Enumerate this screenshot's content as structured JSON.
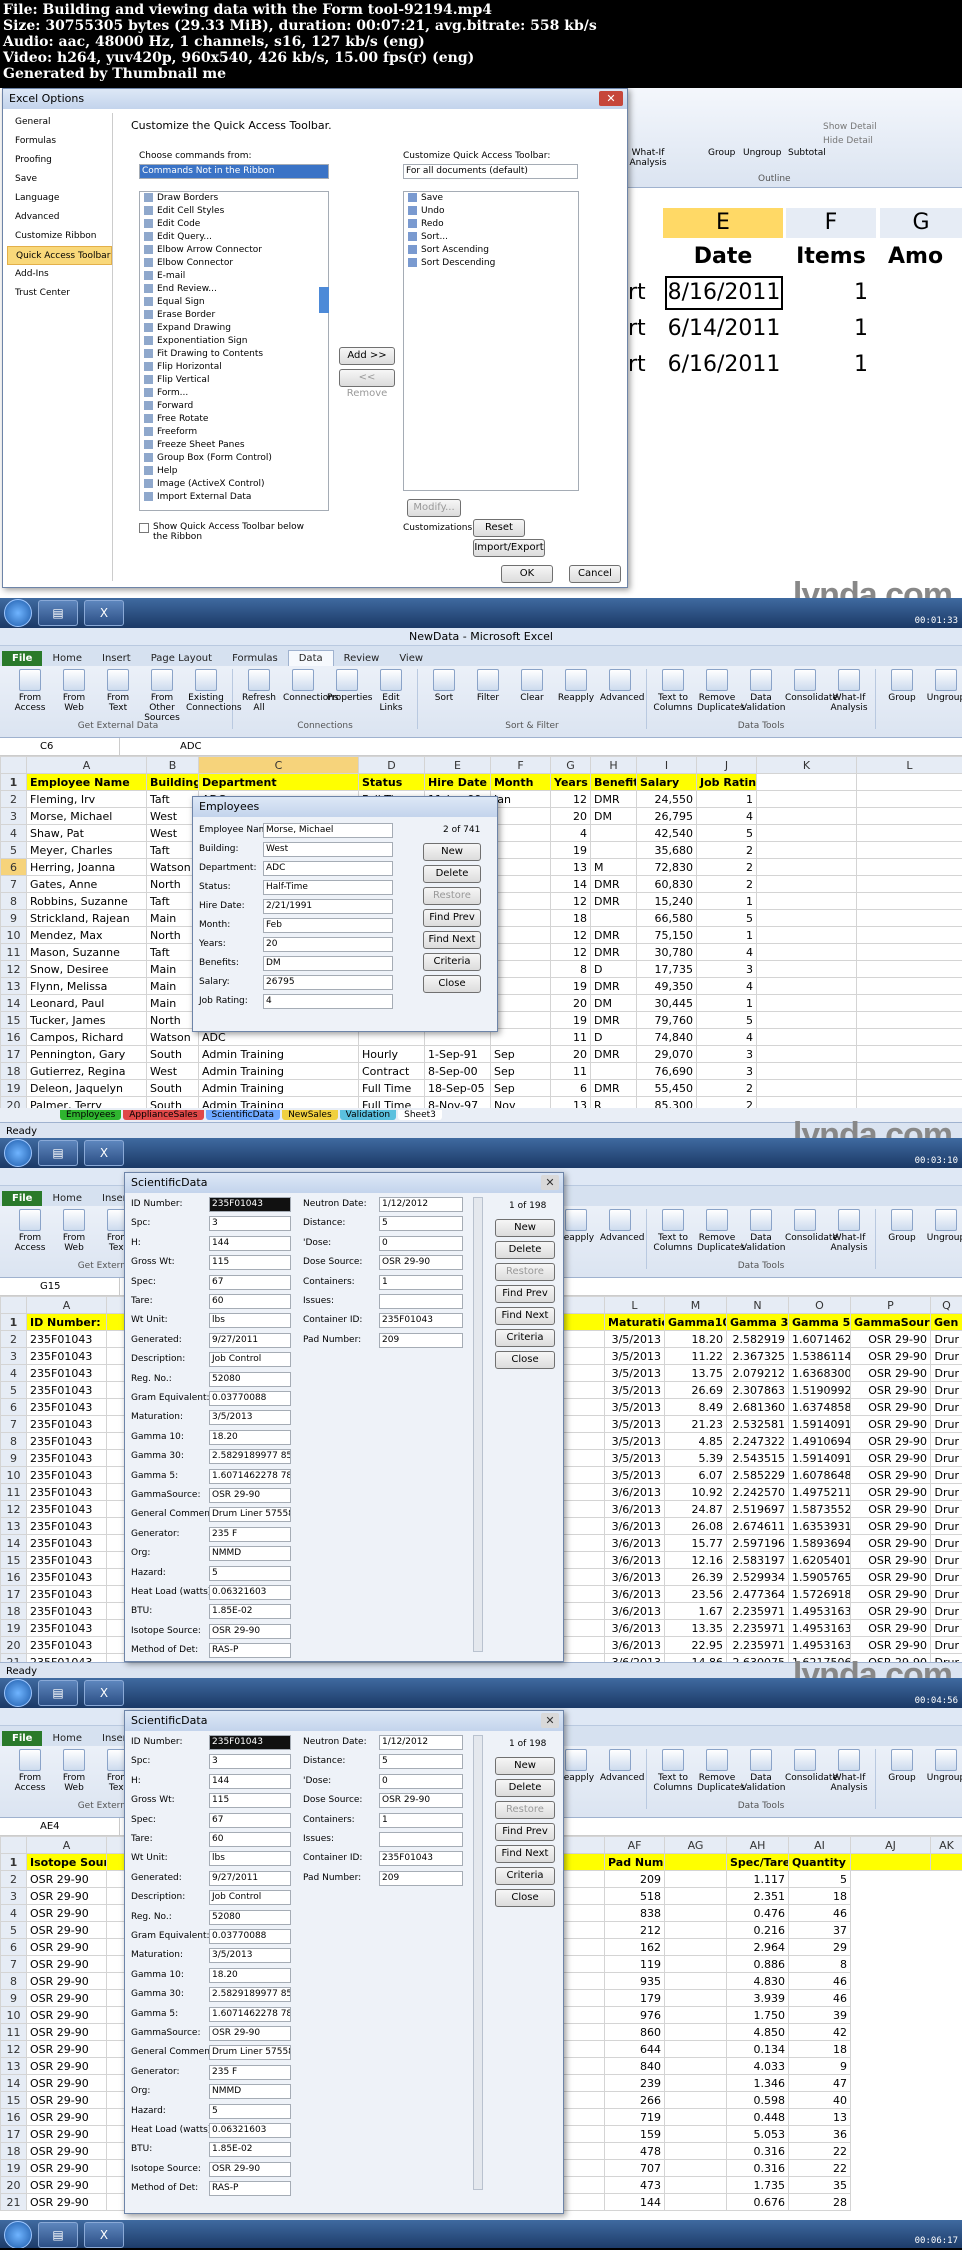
{
  "header": {
    "lines": [
      "File: Building and viewing data with the Form tool-92194.mp4",
      "Size: 30755305 bytes (29.33 MiB), duration: 00:07:21, avg.bitrate: 558 kb/s",
      "Audio: aac, 48000 Hz, 1 channels, s16, 127 kb/s (eng)",
      "Video: h264, yuv420p, 960x540, 426 kb/s, 15.00 fps(r) (eng)",
      "Generated by Thumbnail me"
    ]
  },
  "brand": "lynda.com",
  "timestamps": [
    "00:01:33",
    "00:03:10",
    "00:04:56",
    "00:06:17"
  ],
  "frame1": {
    "dialog_title": "Excel Options",
    "categories": [
      "General",
      "Formulas",
      "Proofing",
      "Save",
      "Language",
      "Advanced",
      "Customize Ribbon",
      "Quick Access Toolbar",
      "Add-Ins",
      "Trust Center"
    ],
    "selected_category": "Quick Access Toolbar",
    "heading": "Customize the Quick Access Toolbar.",
    "choose_label": "Choose commands from:",
    "choose_value": "Commands Not in the Ribbon",
    "customize_label": "Customize Quick Access Toolbar:",
    "customize_value": "For all documents (default)",
    "commands": [
      "Draw Borders",
      "Edit Cell Styles",
      "Edit Code",
      "Edit Query...",
      "Elbow Arrow Connector",
      "Elbow Connector",
      "E-mail",
      "End Review...",
      "Equal Sign",
      "Erase Border",
      "Expand Drawing",
      "Exponentiation Sign",
      "Fit Drawing to Contents",
      "Flip Horizontal",
      "Flip Vertical",
      "Form...",
      "Forward",
      "Free Rotate",
      "Freeform",
      "Freeze Sheet Panes",
      "Group Box (Form Control)",
      "Help",
      "Image (ActiveX Control)",
      "Import External Data"
    ],
    "qat_items": [
      "Save",
      "Undo",
      "Redo",
      "Sort...",
      "Sort Ascending",
      "Sort Descending"
    ],
    "add_btn": "Add >>",
    "remove_btn": "<< Remove",
    "modify_btn": "Modify...",
    "customizations": "Customizations:",
    "reset_btn": "Reset",
    "import_btn": "Import/Export",
    "show_below": "Show Quick Access Toolbar below the Ribbon",
    "ok": "OK",
    "cancel": "Cancel",
    "bg_headers": [
      "E",
      "F",
      "G"
    ],
    "bg_cols": [
      "Date",
      "Items",
      "Amo"
    ],
    "bg_rows": [
      [
        "rt",
        "8/16/2011",
        "1"
      ],
      [
        "rt",
        "6/14/2011",
        "1"
      ],
      [
        "rt",
        "6/16/2011",
        "1"
      ]
    ],
    "bg_ribbon": [
      "date",
      "What-If Analysis",
      "Group",
      "Ungroup",
      "Subtotal",
      "Show Detail",
      "Hide Detail",
      "Outline"
    ]
  },
  "frame2": {
    "window_title": "NewData - Microsoft Excel",
    "tabs": [
      "File",
      "Home",
      "Insert",
      "Page Layout",
      "Formulas",
      "Data",
      "Review",
      "View"
    ],
    "active_tab": "Data",
    "groups": [
      {
        "label": "Get External Data",
        "buttons": [
          "From Access",
          "From Web",
          "From Text",
          "From Other Sources",
          "Existing Connections"
        ]
      },
      {
        "label": "Connections",
        "buttons": [
          "Refresh All",
          "Connections",
          "Properties",
          "Edit Links"
        ]
      },
      {
        "label": "Sort & Filter",
        "buttons": [
          "Sort",
          "Filter",
          "Clear",
          "Reapply",
          "Advanced"
        ]
      },
      {
        "label": "Data Tools",
        "buttons": [
          "Text to Columns",
          "Remove Duplicates",
          "Data Validation",
          "Consolidate",
          "What-If Analysis"
        ]
      },
      {
        "label": "Outline",
        "buttons": [
          "Group",
          "Ungroup",
          "Subtotal",
          "Show Detail",
          "Hide Detail"
        ]
      }
    ],
    "name_box": "C6",
    "formula": "ADC",
    "col_letters": [
      "A",
      "B",
      "C",
      "D",
      "E",
      "F",
      "G",
      "H",
      "I",
      "J",
      "K",
      "L"
    ],
    "headers": [
      "Employee Name",
      "Building",
      "Department",
      "Status",
      "Hire Date",
      "Month",
      "Years",
      "Benefits",
      "Salary",
      "Job Rating"
    ],
    "rows": [
      [
        "Fleming, Irv",
        "Taft",
        "ADC",
        "Full Time",
        "11-Jan-99",
        "Jan",
        "12",
        "DMR",
        "24,550",
        "1"
      ],
      [
        "Morse, Michael",
        "West",
        "ADC",
        "Half-Time",
        "",
        "",
        "20",
        "DM",
        "26,795",
        "4"
      ],
      [
        "Shaw, Pat",
        "West",
        "ADC",
        "",
        "",
        "",
        "4",
        "",
        "42,540",
        "5"
      ],
      [
        "Meyer, Charles",
        "Taft",
        "ADC",
        "",
        "",
        "",
        "19",
        "",
        "35,680",
        "2"
      ],
      [
        "Herring, Joanna",
        "Watson",
        "ADC",
        "",
        "",
        "",
        "13",
        "M",
        "72,830",
        "2"
      ],
      [
        "Gates, Anne",
        "North",
        "ADC",
        "",
        "",
        "",
        "14",
        "DMR",
        "60,830",
        "2"
      ],
      [
        "Robbins, Suzanne",
        "Taft",
        "ADC",
        "",
        "",
        "",
        "12",
        "DMR",
        "15,240",
        "1"
      ],
      [
        "Strickland, Rajean",
        "Main",
        "ADC",
        "",
        "",
        "",
        "18",
        "",
        "66,580",
        "5"
      ],
      [
        "Mendez, Max",
        "North",
        "ADC",
        "",
        "",
        "",
        "12",
        "DMR",
        "75,150",
        "1"
      ],
      [
        "Mason, Suzanne",
        "Taft",
        "ADC",
        "",
        "",
        "",
        "12",
        "DMR",
        "30,780",
        "4"
      ],
      [
        "Snow, Desiree",
        "Main",
        "ADC",
        "",
        "",
        "",
        "8",
        "D",
        "17,735",
        "3"
      ],
      [
        "Flynn, Melissa",
        "Main",
        "ADC",
        "",
        "",
        "",
        "19",
        "DMR",
        "49,350",
        "4"
      ],
      [
        "Leonard, Paul",
        "Main",
        "ADC",
        "",
        "",
        "",
        "20",
        "DM",
        "30,445",
        "1"
      ],
      [
        "Tucker, James",
        "North",
        "ADC",
        "",
        "",
        "",
        "19",
        "DMR",
        "79,760",
        "5"
      ],
      [
        "Campos, Richard",
        "Watson",
        "ADC",
        "",
        "",
        "",
        "11",
        "D",
        "74,840",
        "4"
      ],
      [
        "Pennington, Gary",
        "South",
        "Admin Training",
        "Hourly",
        "1-Sep-91",
        "Sep",
        "20",
        "DMR",
        "29,070",
        "3"
      ],
      [
        "Gutierrez, Regina",
        "West",
        "Admin Training",
        "Contract",
        "8-Sep-00",
        "Sep",
        "11",
        "",
        "76,690",
        "3"
      ],
      [
        "Deleon, Jaquelyn",
        "South",
        "Admin Training",
        "Full Time",
        "18-Sep-05",
        "Sep",
        "6",
        "DMR",
        "55,450",
        "2"
      ],
      [
        "Palmer, Terry",
        "South",
        "Admin Training",
        "Full Time",
        "8-Nov-97",
        "Nov",
        "13",
        "R",
        "85,300",
        "2"
      ]
    ],
    "sheet_tabs": [
      "Employees",
      "ApplianceSales",
      "ScientificData",
      "NewSales",
      "Validation",
      "Sheet3"
    ],
    "status": "Ready",
    "form_title": "Employees",
    "form_record": "2 of 741",
    "form_fields": [
      [
        "Employee Name:",
        "Morse, Michael"
      ],
      [
        "Building:",
        "West"
      ],
      [
        "Department:",
        "ADC"
      ],
      [
        "Status:",
        "Half-Time"
      ],
      [
        "Hire Date:",
        "2/21/1991"
      ],
      [
        "Month:",
        "Feb"
      ],
      [
        "Years:",
        "20"
      ],
      [
        "Benefits:",
        "DM"
      ],
      [
        "Salary:",
        "26795"
      ],
      [
        "Job Rating:",
        "4"
      ]
    ],
    "form_buttons": [
      "New",
      "Delete",
      "Restore",
      "Find Prev",
      "Find Next",
      "Criteria",
      "Close"
    ]
  },
  "frame3": {
    "name_box": "G15",
    "form_title": "ScientificData",
    "form_record": "1 of 198",
    "left_fields": [
      [
        "ID Number:",
        "235F01043"
      ],
      [
        "Spc:",
        "3"
      ],
      [
        "H:",
        "144"
      ],
      [
        "Gross Wt:",
        "115"
      ],
      [
        "Spec:",
        "67"
      ],
      [
        "Tare:",
        "60"
      ],
      [
        "Wt Unit:",
        "lbs"
      ],
      [
        "Generated:",
        "9/27/2011"
      ],
      [
        "Description:",
        "Job Control"
      ],
      [
        "Reg. No.:",
        "52080"
      ],
      [
        "Gram Equivalent:",
        "0.03770088"
      ],
      [
        "Maturation:",
        "3/5/2013"
      ],
      [
        "Gamma 10:",
        "18.20"
      ],
      [
        "Gamma 30:",
        "2.5829189977 8549"
      ],
      [
        "Gamma 5:",
        "1.6071462278 7894"
      ],
      [
        "GammaSource:",
        "OSR 29-90"
      ],
      [
        "General Comments:",
        "Drum Liner 57558"
      ],
      [
        "Generator:",
        "235 F"
      ],
      [
        "Org:",
        "NMMD"
      ],
      [
        "Hazard:",
        "5"
      ],
      [
        "Heat Load (watts):",
        "0.06321603"
      ],
      [
        "BTU:",
        "1.85E-02"
      ],
      [
        "Isotope Source:",
        "OSR 29-90"
      ],
      [
        "Method of Det:",
        "RAS-P"
      ]
    ],
    "right_fields": [
      [
        "Neutron Date:",
        "1/12/2012"
      ],
      [
        "Distance:",
        "5"
      ],
      [
        "'Dose:",
        "0"
      ],
      [
        "Dose Source:",
        "OSR 29-90"
      ],
      [
        "Containers:",
        "1"
      ],
      [
        "Issues:",
        ""
      ],
      [
        "Container ID:",
        "235F01043"
      ],
      [
        "Pad Number:",
        "209"
      ]
    ],
    "form_buttons": [
      "New",
      "Delete",
      "Restore",
      "Find Prev",
      "Find Next",
      "Criteria",
      "Close"
    ],
    "bg_col_letters": [
      "L",
      "M",
      "N",
      "O",
      "P",
      "Q"
    ],
    "bg_headers": [
      "Maturation",
      "Gamma10",
      "Gamma 30",
      "Gamma 5",
      "GammaSource",
      "Gen"
    ],
    "bg_rows": [
      [
        "3/5/2013",
        "18.20",
        "2.582919",
        "1.607146228",
        "OSR 29-90",
        "Drur"
      ],
      [
        "3/5/2013",
        "11.22",
        "2.367325",
        "1.53861148",
        "OSR 29-90",
        "Drur"
      ],
      [
        "3/5/2013",
        "13.75",
        "2.079212",
        "1.636830008",
        "OSR 29-90",
        "Drur"
      ],
      [
        "3/5/2013",
        "26.69",
        "2.307863",
        "1.519099293",
        "OSR 29-90",
        "Drur"
      ],
      [
        "3/5/2013",
        "8.49",
        "2.681360",
        "1.637485848",
        "OSR 29-90",
        "Drur"
      ],
      [
        "3/5/2013",
        "21.23",
        "2.532581",
        "1.59140914",
        "OSR 29-90",
        "Drur"
      ],
      [
        "3/5/2013",
        "4.85",
        "2.247322",
        "1.49106943",
        "OSR 29-90",
        "Drur"
      ],
      [
        "3/5/2013",
        "5.39",
        "2.543515",
        "1.59140914",
        "OSR 29-90",
        "Drur"
      ],
      [
        "3/5/2013",
        "6.07",
        "2.585229",
        "1.607864825",
        "OSR 29-90",
        "Drur"
      ],
      [
        "3/6/2013",
        "10.92",
        "2.242570",
        "1.497521171",
        "OSR 29-90",
        "Drur"
      ],
      [
        "3/6/2013",
        "24.87",
        "2.519697",
        "1.587355267",
        "OSR 29-90",
        "Drur"
      ],
      [
        "3/6/2013",
        "26.08",
        "2.674611",
        "1.635393162",
        "OSR 29-90",
        "Drur"
      ],
      [
        "3/6/2013",
        "15.77",
        "2.597196",
        "1.589369442",
        "OSR 29-90",
        "Drur"
      ],
      [
        "3/6/2013",
        "12.16",
        "2.583197",
        "1.620540166",
        "OSR 29-90",
        "Drur"
      ],
      [
        "3/6/2013",
        "26.39",
        "2.529934",
        "1.590576551",
        "OSR 29-90",
        "Drur"
      ],
      [
        "3/6/2013",
        "23.56",
        "2.477364",
        "1.572691844",
        "OSR 29-90",
        "Drur"
      ],
      [
        "3/6/2013",
        "1.67",
        "2.235971",
        "1.49531631",
        "OSR 29-90",
        "Drur"
      ],
      [
        "3/6/2013",
        "13.35",
        "2.235971",
        "1.49531631",
        "OSR 29-90",
        "Drur"
      ],
      [
        "3/6/2013",
        "22.95",
        "2.235971",
        "1.49531631",
        "OSR 29-90",
        "Drur"
      ],
      [
        "3/6/2013",
        "14.86",
        "2.630075",
        "1.621750624",
        "OSR 29-90",
        "Drur"
      ]
    ]
  },
  "frame4": {
    "name_box": "AE4",
    "bg_col_letters": [
      "AF",
      "AG",
      "AH",
      "AI",
      "AJ",
      "AK"
    ],
    "bg_headers": [
      "Pad Number",
      "",
      "Spec/Tare",
      "Quantity",
      "",
      ""
    ],
    "bg_rows": [
      [
        "209",
        "",
        "1.117",
        "5"
      ],
      [
        "518",
        "",
        "2.351",
        "18"
      ],
      [
        "838",
        "",
        "0.476",
        "46"
      ],
      [
        "212",
        "",
        "0.216",
        "37"
      ],
      [
        "162",
        "",
        "2.964",
        "29"
      ],
      [
        "119",
        "",
        "0.886",
        "8"
      ],
      [
        "935",
        "",
        "4.830",
        "46"
      ],
      [
        "179",
        "",
        "3.939",
        "46"
      ],
      [
        "976",
        "",
        "1.750",
        "39"
      ],
      [
        "860",
        "",
        "4.850",
        "42"
      ],
      [
        "644",
        "",
        "0.134",
        "18"
      ],
      [
        "840",
        "",
        "4.033",
        "9"
      ],
      [
        "239",
        "",
        "1.346",
        "47"
      ],
      [
        "266",
        "",
        "0.598",
        "40"
      ],
      [
        "719",
        "",
        "0.448",
        "13"
      ],
      [
        "159",
        "",
        "5.053",
        "36"
      ],
      [
        "478",
        "",
        "0.316",
        "22"
      ],
      [
        "707",
        "",
        "0.316",
        "22"
      ],
      [
        "473",
        "",
        "1.735",
        "35"
      ],
      [
        "144",
        "",
        "0.676",
        "28"
      ]
    ],
    "left_col": [
      "Isotope Source",
      "OSR 29-90"
    ]
  }
}
